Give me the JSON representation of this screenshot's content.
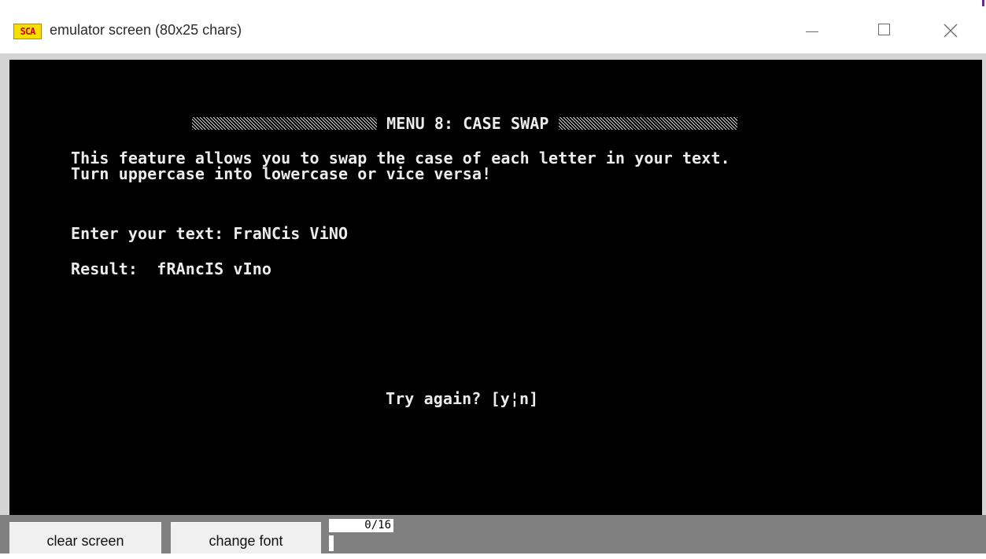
{
  "window": {
    "title": "emulator screen (80x25 chars)",
    "icon_label": "SCA",
    "controls": {
      "minimize_icon": "minimize-icon",
      "maximize_icon": "maximize-icon",
      "close_icon": "close-icon"
    }
  },
  "screen": {
    "heading": "MENU 8: CASE SWAP",
    "description_line1": "This feature allows you to swap the case of each letter in your text.",
    "description_line2": "Turn uppercase into lowercase or vice versa!",
    "input_label": "Enter your text:",
    "input_value": "FraNCis ViNO",
    "result_label": "Result:",
    "result_value": "fRAncIS vIno",
    "prompt": "Try again? [y¦n]"
  },
  "toolbar": {
    "clear_label": "clear screen",
    "font_label": "change font",
    "counter": "0/16"
  },
  "colors": {
    "screen_bg": "#000000",
    "screen_text": "#ececec",
    "bottom_bar": "#808080",
    "icon_bg": "#f7e000",
    "icon_text": "#d40000"
  }
}
